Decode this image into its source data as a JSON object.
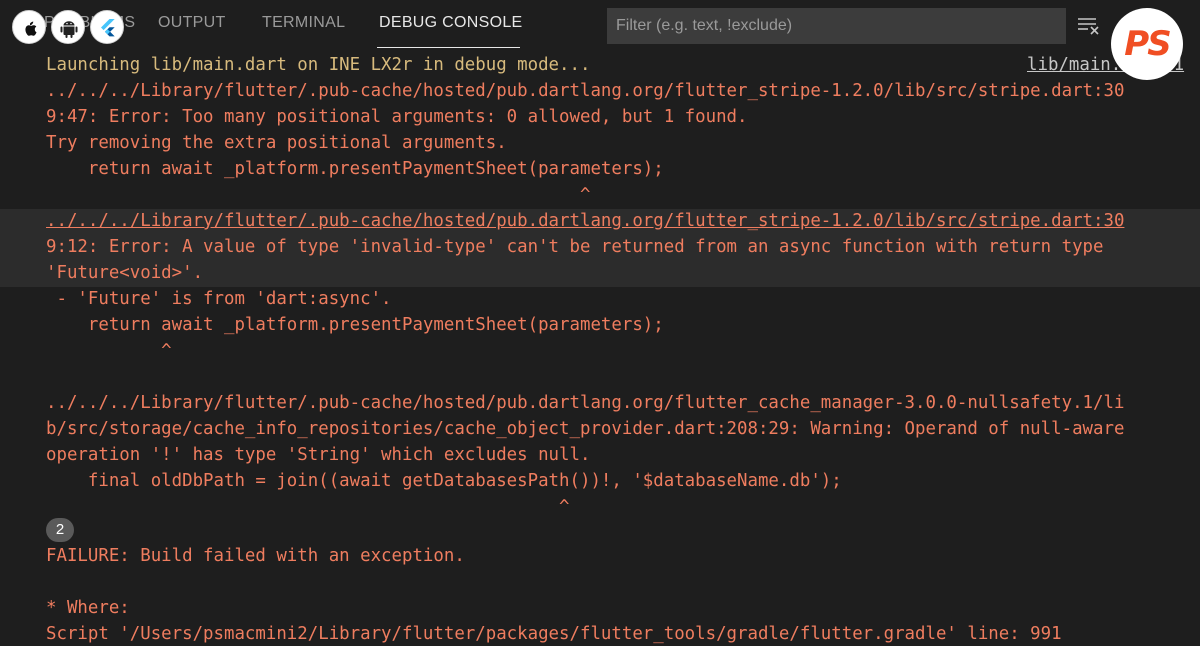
{
  "panel": {
    "tabs": [
      {
        "label": "PROBLEMS",
        "active": false
      },
      {
        "label": "OUTPUT",
        "active": false
      },
      {
        "label": "TERMINAL",
        "active": false
      },
      {
        "label": "DEBUG CONSOLE",
        "active": true
      }
    ],
    "filter_placeholder": "Filter (e.g. text, !exclude)",
    "clear_icon": "clear-console-icon"
  },
  "overlay": {
    "platform_icons": [
      "apple-icon",
      "android-icon",
      "flutter-icon"
    ],
    "logo_text": "PS",
    "accent_color": "#f04e23"
  },
  "console": {
    "launch": "Launching lib/main.dart on INE LX2r in debug mode...",
    "launch_link": "lib/main.dart:1",
    "error1": [
      "../../../Library/flutter/.pub-cache/hosted/pub.dartlang.org/flutter_stripe-1.2.0/lib/src/stripe.dart:30",
      "9:47: Error: Too many positional arguments: 0 allowed, but 1 found.",
      "Try removing the extra positional arguments.",
      "    return await _platform.presentPaymentSheet(parameters);",
      "                                                   ^"
    ],
    "error2": [
      "../../../Library/flutter/.pub-cache/hosted/pub.dartlang.org/flutter_stripe-1.2.0/lib/src/stripe.dart:30",
      "9:12: Error: A value of type 'invalid-type' can't be returned from an async function with return type",
      "'Future<void>'.",
      " - 'Future' is from 'dart:async'.",
      "    return await _platform.presentPaymentSheet(parameters);",
      "           ^"
    ],
    "warning": [
      "../../../Library/flutter/.pub-cache/hosted/pub.dartlang.org/flutter_cache_manager-3.0.0-nullsafety.1/li",
      "b/src/storage/cache_info_repositories/cache_object_provider.dart:208:29: Warning: Operand of null-aware",
      "operation '!' has type 'String' which excludes null.",
      "    final oldDbPath = join((await getDatabasesPath())!, '$databaseName.db');",
      "                                                 ^"
    ],
    "repeat_badge": "2",
    "failure": "FAILURE: Build failed with an exception.",
    "where": "* Where:",
    "script": "Script '/Users/psmacmini2/Library/flutter/packages/flutter_tools/gradle/flutter.gradle' line: 991"
  },
  "colors": {
    "background": "#1e1e1e",
    "error_text": "#ef7d5f",
    "launch_text": "#d7ba7d",
    "highlight_row": "#2c2c2c"
  }
}
